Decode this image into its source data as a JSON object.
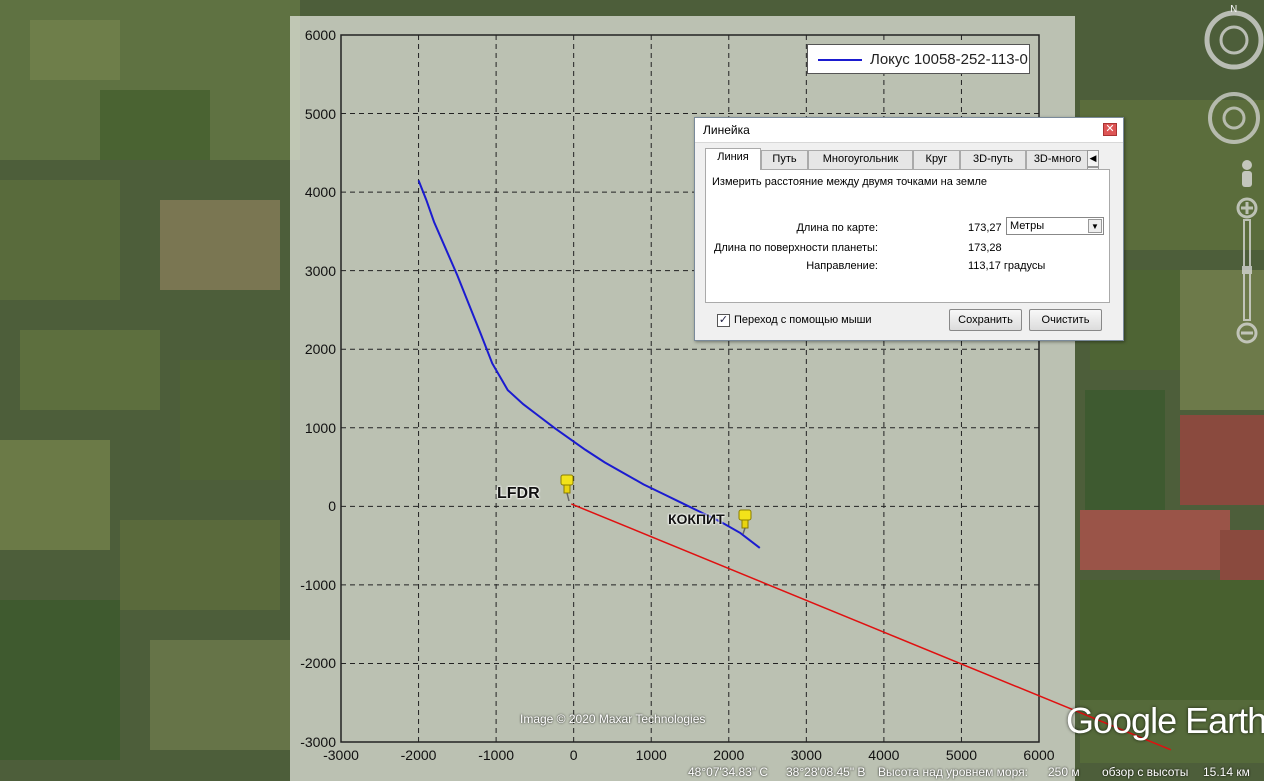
{
  "chart_data": {
    "type": "line",
    "xlim": [
      -3000,
      6000
    ],
    "ylim": [
      -3000,
      6000
    ],
    "x_ticks": [
      "-3000",
      "-2000",
      "-1000",
      "0",
      "1000",
      "2000",
      "3000",
      "4000",
      "5000",
      "6000"
    ],
    "y_ticks": [
      "6000",
      "5000",
      "4000",
      "3000",
      "2000",
      "1000",
      "0",
      "-1000",
      "-2000",
      "-3000"
    ],
    "grid": true,
    "legend_position": "top-right",
    "series": [
      {
        "name": "Локус 10058-252-113-0",
        "color": "#1b1bd0",
        "x": [
          -2000,
          -1900,
          -1800,
          -1650,
          -1500,
          -1350,
          -1200,
          -1050,
          -850,
          -650,
          -450,
          -250,
          -50,
          150,
          400,
          650,
          900,
          1150,
          1400,
          1650,
          1900,
          2150,
          2400
        ],
        "y": [
          4150,
          3900,
          3620,
          3280,
          2940,
          2570,
          2200,
          1820,
          1480,
          1300,
          1150,
          1000,
          860,
          720,
          560,
          420,
          280,
          160,
          40,
          -80,
          -200,
          -340,
          -530
        ]
      }
    ],
    "annotations": [
      {
        "label": "LFDR",
        "x": -100,
        "y": 150
      },
      {
        "label": "КОКПИТ",
        "x": 2200,
        "y": -100
      }
    ],
    "ruler_line": {
      "color": "#e01010",
      "x": [
        -30,
        7700
      ],
      "y": 30,
      "y_end": -3100
    }
  },
  "legend": {
    "label": "Локус 10058-252-113-0"
  },
  "pins": {
    "lfdr": "LFDR",
    "kokpit": "КОКПИТ"
  },
  "imagery_credit": "Image © 2020 Maxar Technologies",
  "logo": {
    "google": "Google",
    "earth": "Earth"
  },
  "status": {
    "lat": "48°07'34.83\" С",
    "lon": "38°28'08.45\" В",
    "elevation_label": "Высота над уровнем моря:",
    "elevation_value": "250 м",
    "eye_label": "обзор с высоты",
    "eye_value": "15.14 км"
  },
  "ruler_dialog": {
    "title": "Линейка",
    "tabs": [
      "Линия",
      "Путь",
      "Многоугольник",
      "Круг",
      "3D-путь",
      "3D-много"
    ],
    "active_tab": "Линия",
    "description": "Измерить расстояние между двумя точками на земле",
    "map_length_label": "Длина по карте:",
    "map_length_value": "173,27",
    "units": "Метры",
    "ground_length_label": "Длина по поверхности планеты:",
    "ground_length_value": "173,28",
    "heading_label": "Направление:",
    "heading_value": "113,17 градусы",
    "mouse_nav_label": "Переход с помощью мыши",
    "mouse_nav_checked": true,
    "save_label": "Сохранить",
    "clear_label": "Очистить"
  },
  "colors": {
    "series": "#1b1bd0",
    "ruler": "#e01010",
    "pin": "#f2e21a"
  }
}
